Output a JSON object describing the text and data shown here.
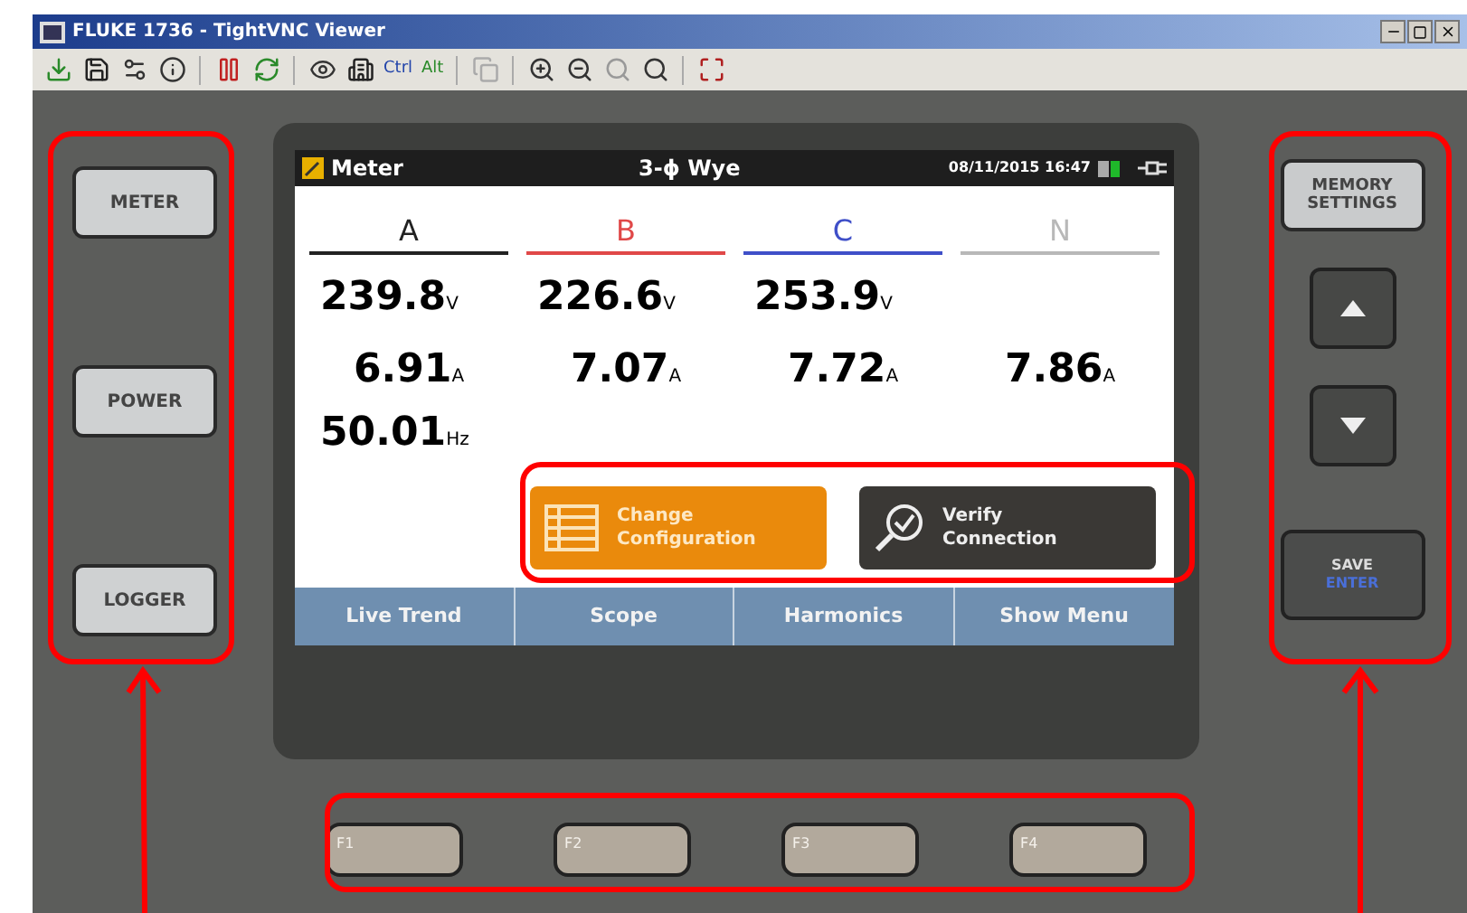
{
  "window": {
    "title": "FLUKE 1736 - TightVNC Viewer"
  },
  "toolbar": {
    "labels": [
      "Ctrl",
      "Alt"
    ]
  },
  "side_keys_left": [
    "METER",
    "POWER",
    "LOGGER"
  ],
  "side_keys_right": [
    {
      "kind": "text",
      "label": "MEMORY SETTINGS"
    },
    {
      "kind": "up"
    },
    {
      "kind": "down"
    },
    {
      "kind": "save",
      "label": "SAVE",
      "sublabel": "ENTER"
    }
  ],
  "display": {
    "title": "Meter",
    "mode": "3-ϕ Wye",
    "datetime": "08/11/2015 16:47",
    "phases": [
      {
        "label": "A",
        "color": "#222222",
        "voltage": "239.8",
        "voltage_unit": "V",
        "current": "6.91",
        "current_unit": "A"
      },
      {
        "label": "B",
        "color": "#e04848",
        "voltage": "226.6",
        "voltage_unit": "V",
        "current": "7.07",
        "current_unit": "A"
      },
      {
        "label": "C",
        "color": "#3f4fc8",
        "voltage": "253.9",
        "voltage_unit": "V",
        "current": "7.72",
        "current_unit": "A"
      },
      {
        "label": "N",
        "color": "#b8b8b8",
        "current": "7.86",
        "current_unit": "A"
      }
    ],
    "frequency": "50.01",
    "frequency_unit": "Hz",
    "actions": [
      {
        "kind": "config",
        "label": "Change Configuration"
      },
      {
        "kind": "verify",
        "label": "Verify Connection"
      }
    ],
    "softkeys": [
      "Live Trend",
      "Scope",
      "Harmonics",
      "Show Menu"
    ]
  },
  "function_keys": [
    "F1",
    "F2",
    "F3",
    "F4"
  ]
}
